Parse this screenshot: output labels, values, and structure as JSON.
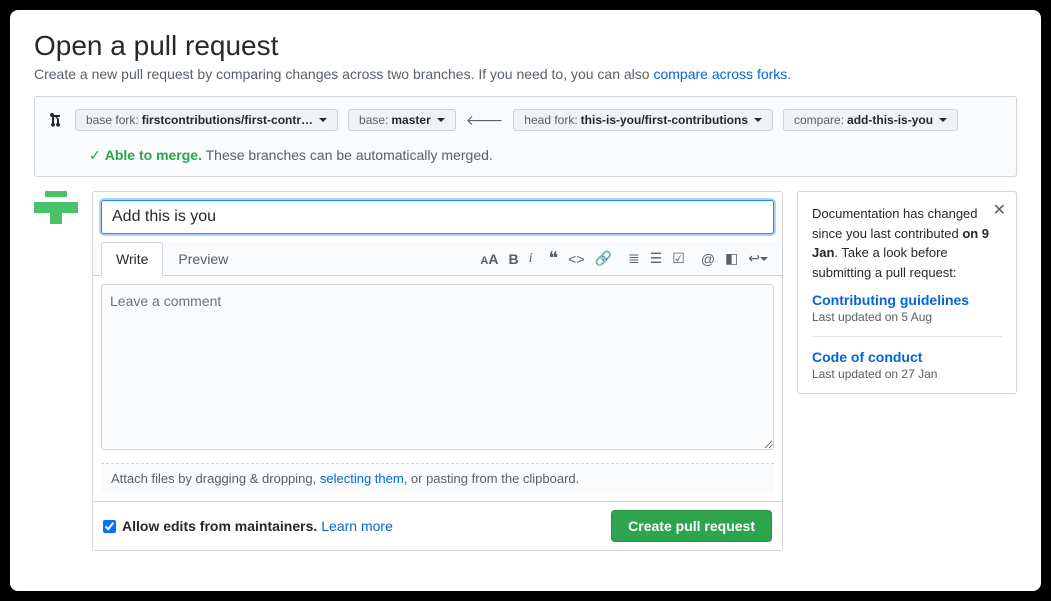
{
  "header": {
    "title": "Open a pull request",
    "subtitle_pre": "Create a new pull request by comparing changes across two branches. If you need to, you can also ",
    "subtitle_link": "compare across forks",
    "subtitle_post": "."
  },
  "compare": {
    "base_fork_label": "base fork: ",
    "base_fork_value": "firstcontributions/first-contr…",
    "base_label": "base: ",
    "base_value": "master",
    "head_fork_label": "head fork: ",
    "head_fork_value": "this-is-you/first-contributions",
    "compare_label": "compare: ",
    "compare_value": "add-this-is-you"
  },
  "merge": {
    "status": "Able to merge.",
    "detail": " These branches can be automatically merged."
  },
  "composer": {
    "title_value": "Add this is you",
    "tabs": {
      "write": "Write",
      "preview": "Preview"
    },
    "comment_placeholder": "Leave a comment",
    "attach_pre": "Attach files by dragging & dropping, ",
    "attach_link": "selecting them",
    "attach_post": ", or pasting from the clipboard.",
    "allow_edits": "Allow edits from maintainers.",
    "learn_more": "Learn more",
    "create_button": "Create pull request"
  },
  "sidebar": {
    "msg_pre": "Documentation has changed since you last contributed ",
    "msg_date": "on 9 Jan",
    "msg_post": ". Take a look before submitting a pull request:",
    "docs": [
      {
        "title": "Contributing guidelines",
        "meta": "Last updated on 5 Aug"
      },
      {
        "title": "Code of conduct",
        "meta": "Last updated on 27 Jan"
      }
    ]
  }
}
